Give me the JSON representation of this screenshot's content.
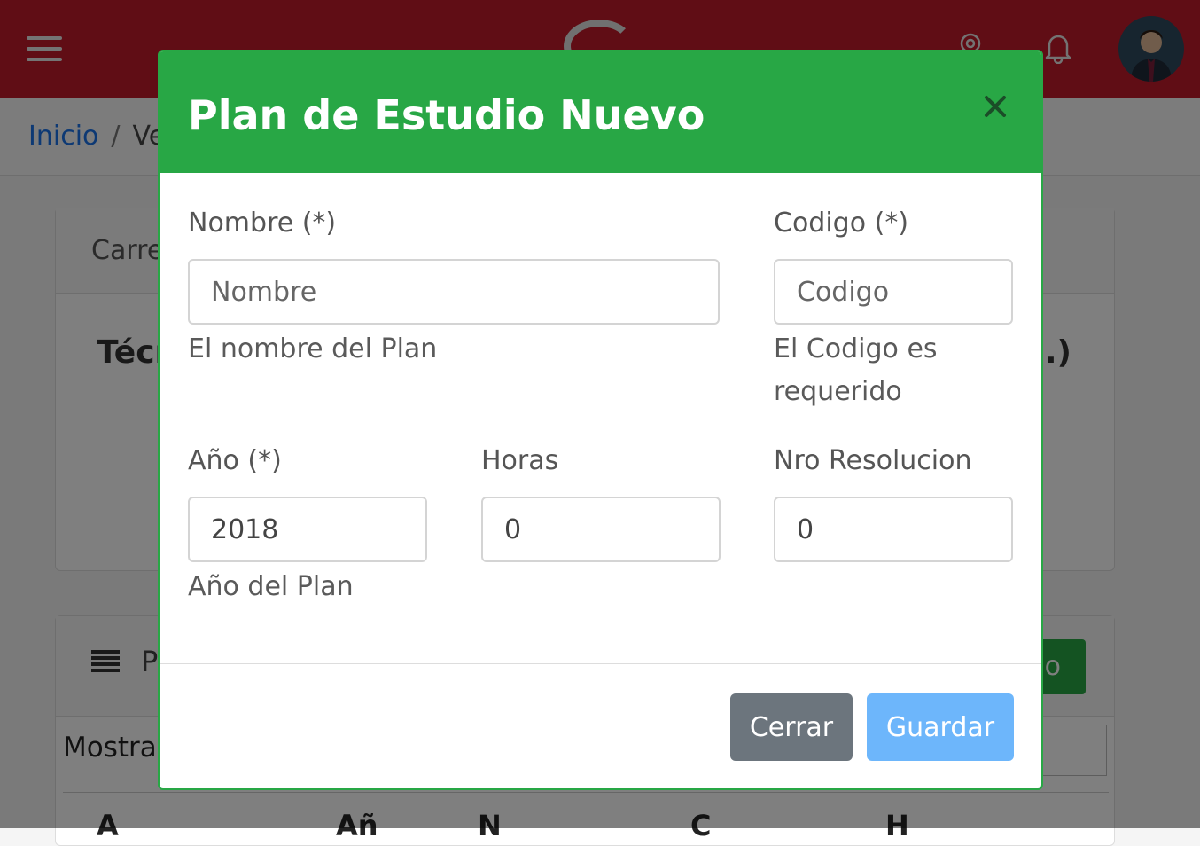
{
  "background": {
    "breadcrumb": {
      "home": "Inicio",
      "separator": "/",
      "current": "Ve"
    },
    "card1": {
      "header": "Carre",
      "title": "Técr",
      "right_text": "d.)"
    },
    "card2": {
      "title": "P",
      "button": "dio",
      "mostrar": "Mostrar",
      "table_headers": [
        "A",
        "Añ",
        "N",
        "C",
        "H"
      ]
    }
  },
  "modal": {
    "title": "Plan de Estudio Nuevo",
    "close_symbol": "×",
    "fields": {
      "nombre": {
        "label": "Nombre (*)",
        "placeholder": "Nombre",
        "value": "",
        "help": "El nombre del Plan"
      },
      "codigo": {
        "label": "Codigo (*)",
        "placeholder": "Codigo",
        "value": "",
        "help_line1": "El Codigo es",
        "help_line2": "requerido"
      },
      "anio": {
        "label": "Año (*)",
        "value": "2018",
        "help": "Año del Plan"
      },
      "horas": {
        "label": "Horas",
        "value": "0"
      },
      "nro_resolucion": {
        "label": "Nro Resolucion",
        "value": "0"
      }
    },
    "buttons": {
      "cerrar": "Cerrar",
      "guardar": "Guardar"
    }
  },
  "colors": {
    "topbar": "#c11a2b",
    "modal_header": "#28a745",
    "btn_cerrar": "#6c757d",
    "btn_guardar": "#6db6fb",
    "link": "#1a73e8"
  },
  "icons": [
    "hamburger-icon",
    "logo-icon",
    "location-icon",
    "bell-icon",
    "avatar",
    "list-icon",
    "close-icon"
  ]
}
